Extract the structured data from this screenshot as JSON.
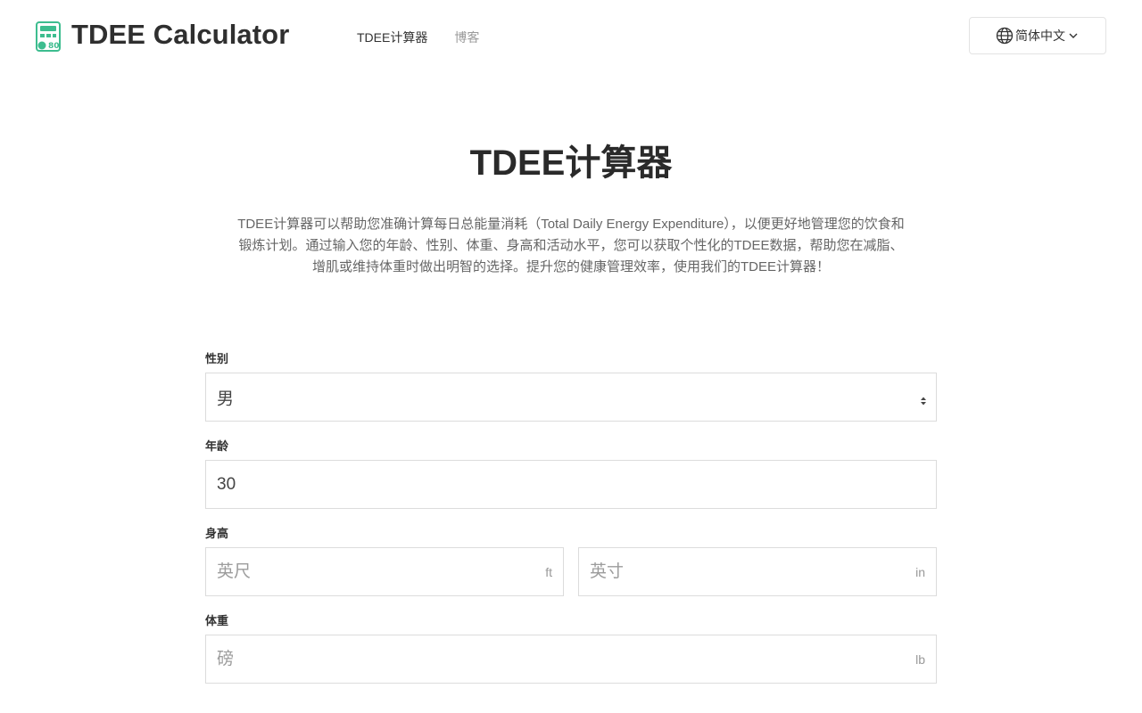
{
  "header": {
    "brand": "TDEE Calculator",
    "nav": [
      {
        "label": "TDEE计算器"
      },
      {
        "label": "博客"
      }
    ],
    "language": "简体中文"
  },
  "hero": {
    "title": "TDEE计算器",
    "description": "TDEE计算器可以帮助您准确计算每日总能量消耗（Total Daily Energy Expenditure），以便更好地管理您的饮食和锻炼计划。通过输入您的年龄、性别、体重、身高和活动水平，您可以获取个性化的TDEE数据，帮助您在减脂、增肌或维持体重时做出明智的选择。提升您的健康管理效率，使用我们的TDEE计算器！"
  },
  "form": {
    "gender": {
      "label": "性别",
      "value": "男"
    },
    "age": {
      "label": "年龄",
      "value": "30"
    },
    "height": {
      "label": "身高",
      "feet": {
        "placeholder": "英尺",
        "unit": "ft"
      },
      "inches": {
        "placeholder": "英寸",
        "unit": "in"
      }
    },
    "weight": {
      "label": "体重",
      "placeholder": "磅",
      "unit": "lb"
    }
  },
  "colors": {
    "brand_green": "#3dbd8f",
    "text": "#333333",
    "muted": "#9a9a9a",
    "border": "#dcdcdc"
  }
}
